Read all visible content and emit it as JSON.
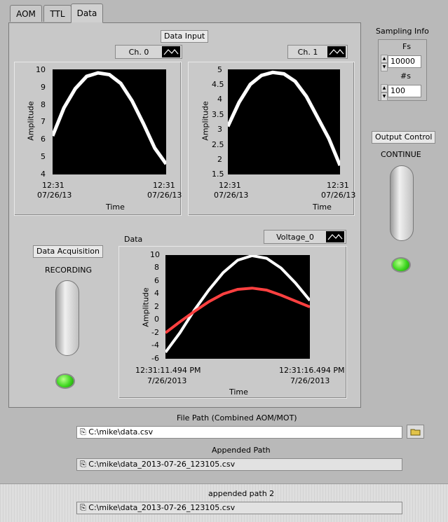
{
  "tabs": [
    {
      "label": "AOM"
    },
    {
      "label": "TTL"
    },
    {
      "label": "Data"
    }
  ],
  "data_input_label": "Data Input",
  "ch0": {
    "name": "Ch. 0",
    "ylabel": "Amplitude",
    "xlabel": "Time",
    "yticks": [
      "10",
      "9",
      "8",
      "7",
      "6",
      "5",
      "4"
    ],
    "xticks": [
      {
        "l1": "12:31",
        "l2": "07/26/13"
      },
      {
        "l1": "12:31",
        "l2": "07/26/13"
      }
    ]
  },
  "ch1": {
    "name": "Ch. 1",
    "ylabel": "Amplitude",
    "xlabel": "Time",
    "yticks": [
      "5",
      "4.5",
      "4",
      "3.5",
      "3",
      "2.5",
      "2",
      "1.5"
    ],
    "xticks": [
      {
        "l1": "12:31",
        "l2": "07/26/13"
      },
      {
        "l1": "12:31",
        "l2": "07/26/13"
      }
    ]
  },
  "sampling": {
    "label": "Sampling Info",
    "fs_label": "Fs",
    "fs_value": "10000",
    "ns_label": "#s",
    "ns_value": "100"
  },
  "output_control": {
    "label": "Output Control",
    "state": "CONTINUE"
  },
  "data_acq": {
    "label": "Data Acquisition",
    "state": "RECORDING"
  },
  "data_chart": {
    "title": "Data",
    "channel": "Voltage_0",
    "ylabel": "Amplitude",
    "xlabel": "Time",
    "yticks": [
      "10",
      "8",
      "6",
      "4",
      "2",
      "0",
      "-2",
      "-4",
      "-6"
    ],
    "xticks": [
      {
        "l1": "12:31:11.494 PM",
        "l2": "7/26/2013"
      },
      {
        "l1": "12:31:16.494 PM",
        "l2": "7/26/2013"
      }
    ]
  },
  "file_path": {
    "label": "File Path  (Combined AOM/MOT)",
    "value": "C:\\mike\\data.csv"
  },
  "appended_path": {
    "label": "Appended Path",
    "value": "C:\\mike\\data_2013-07-26_123105.csv"
  },
  "appended_path2": {
    "label": "appended path 2",
    "value": "C:\\mike\\data_2013-07-26_123105.csv"
  },
  "colors": {
    "series_white": "#ffffff",
    "series_red": "#ff4040",
    "panel": "#c8c8c8",
    "background": "#b9b9b9"
  },
  "chart_data": [
    {
      "type": "line",
      "title": "Ch. 0",
      "xlabel": "Time",
      "ylabel": "Amplitude",
      "ylim": [
        4,
        10
      ],
      "series": [
        {
          "values": [
            6.2,
            7.8,
            8.9,
            9.6,
            9.8,
            9.7,
            9.2,
            8.2,
            6.9,
            5.5,
            4.6
          ]
        }
      ]
    },
    {
      "type": "line",
      "title": "Ch. 1",
      "xlabel": "Time",
      "ylabel": "Amplitude",
      "ylim": [
        1.5,
        5
      ],
      "series": [
        {
          "values": [
            3.1,
            3.9,
            4.5,
            4.8,
            4.9,
            4.85,
            4.6,
            4.1,
            3.4,
            2.7,
            1.8
          ]
        }
      ]
    },
    {
      "type": "line",
      "title": "Data",
      "xlabel": "Time",
      "ylabel": "Amplitude",
      "ylim": [
        -6,
        10
      ],
      "series": [
        {
          "values": [
            -5,
            -2,
            1.5,
            4.6,
            7.3,
            9.2,
            9.9,
            9.5,
            8,
            5.7,
            3
          ]
        },
        {
          "values": [
            -2,
            -0.3,
            1.3,
            2.8,
            4,
            4.7,
            4.9,
            4.6,
            3.8,
            2.9,
            2
          ]
        }
      ]
    }
  ]
}
